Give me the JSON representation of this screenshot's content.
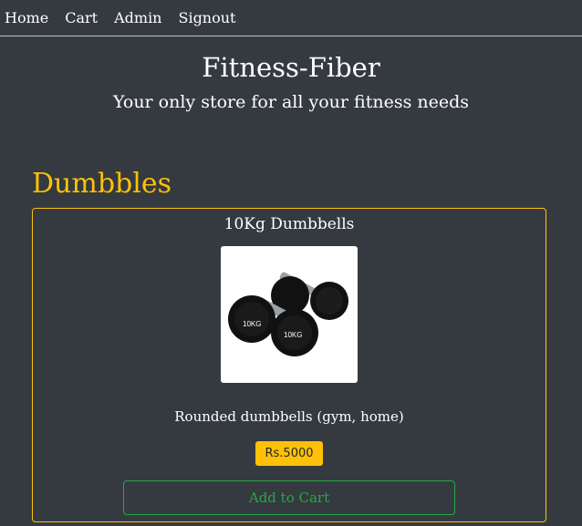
{
  "nav": {
    "items": [
      "Home",
      "Cart",
      "Admin",
      "Signout"
    ]
  },
  "hero": {
    "title": "Fitness-Fiber",
    "tagline": "Your only store for all your fitness needs"
  },
  "section": {
    "title": "Dumbbles"
  },
  "product": {
    "name": "10Kg Dumbbells",
    "image_label": "10KG",
    "description": "Rounded dumbbells (gym, home)",
    "price": "Rs.5000",
    "add_to_cart_label": "Add to Cart"
  },
  "colors": {
    "background": "#343a40",
    "accent": "#ffc107",
    "success": "#28a745"
  }
}
